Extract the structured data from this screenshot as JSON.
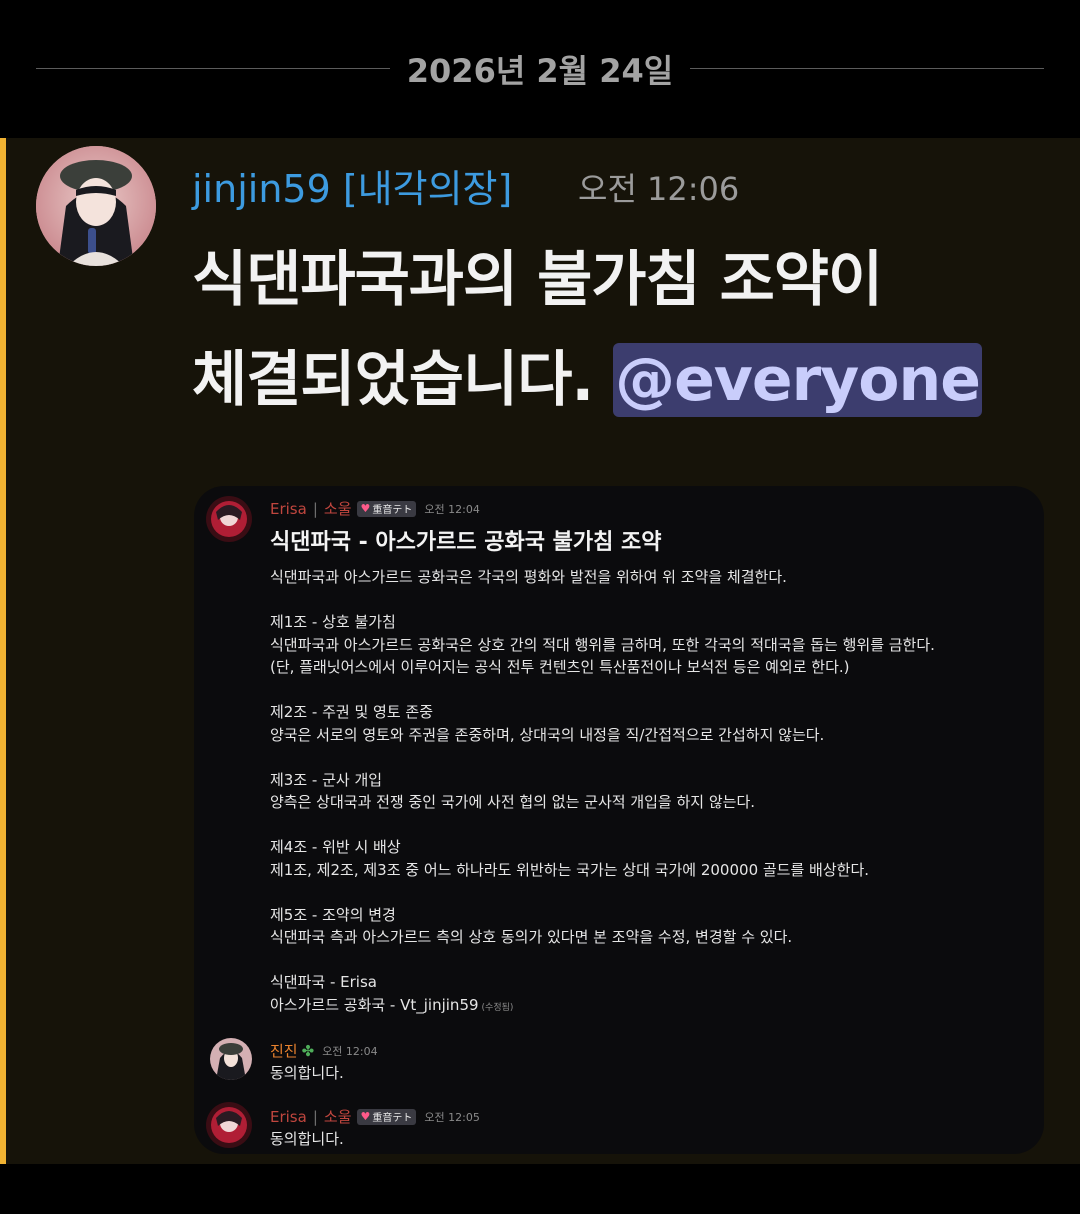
{
  "date_divider": "2026년 2월 24일",
  "message": {
    "author": "jinjin59 [내각의장]",
    "timestamp": "오전 12:06",
    "content_line1": "식댄파국과의 불가침 조약이",
    "content_line2": "체결되었습니다.",
    "mention": "@everyone"
  },
  "embed": {
    "header": {
      "name": "Erisa",
      "separator": "|",
      "suffix": "소울",
      "badge": "重音テト",
      "time": "오전 12:04"
    },
    "title": "식댄파국 - 아스가르드 공화국 불가침 조약",
    "body": "식댄파국과 아스가르드 공화국은 각국의 평화와 발전을 위하여 위 조약을 체결한다.\n\n제1조 - 상호 불가침\n식댄파국과 아스가르드 공화국은 상호 간의 적대 행위를 금하며, 또한 각국의 적대국을 돕는 행위를 금한다.\n(단, 플래닛어스에서 이루어지는 공식 전투 컨텐츠인 특산품전이나 보석전 등은 예외로 한다.)\n\n제2조 - 주권 및 영토 존중\n양국은 서로의 영토와 주권을 존중하며, 상대국의 내정을 직/간접적으로 간섭하지 않는다.\n\n제3조 - 군사 개입\n양측은 상대국과 전쟁 중인 국가에 사전 협의 없는 군사적 개입을 하지 않는다.\n\n제4조 - 위반 시 배상\n제1조, 제2조, 제3조 중 어느 하나라도 위반하는 국가는 상대 국가에 200000 골드를 배상한다.\n\n제5조 - 조약의 변경\n식댄파국 측과 아스가르드 측의 상호 동의가 있다면 본 조약을 수정, 변경할 수 있다.\n\n식댄파국 - Erisa\n아스가르드 공화국 - Vt_jinjin59",
    "edited": "(수정됨)",
    "reply1": {
      "name": "진진",
      "time": "오전 12:04",
      "text": "동의합니다."
    },
    "reply2": {
      "name": "Erisa",
      "separator": "|",
      "suffix": "소울",
      "badge": "重音テト",
      "time": "오전 12:05",
      "text": "동의합니다."
    }
  },
  "colors": {
    "accent_bar": "#f0b232",
    "author": "#3d9be0",
    "mention_bg": "#3c3d6e",
    "mention_text": "#c9cdfb",
    "erisa_name": "#c0463e",
    "jinjin_name": "#e8822e"
  }
}
